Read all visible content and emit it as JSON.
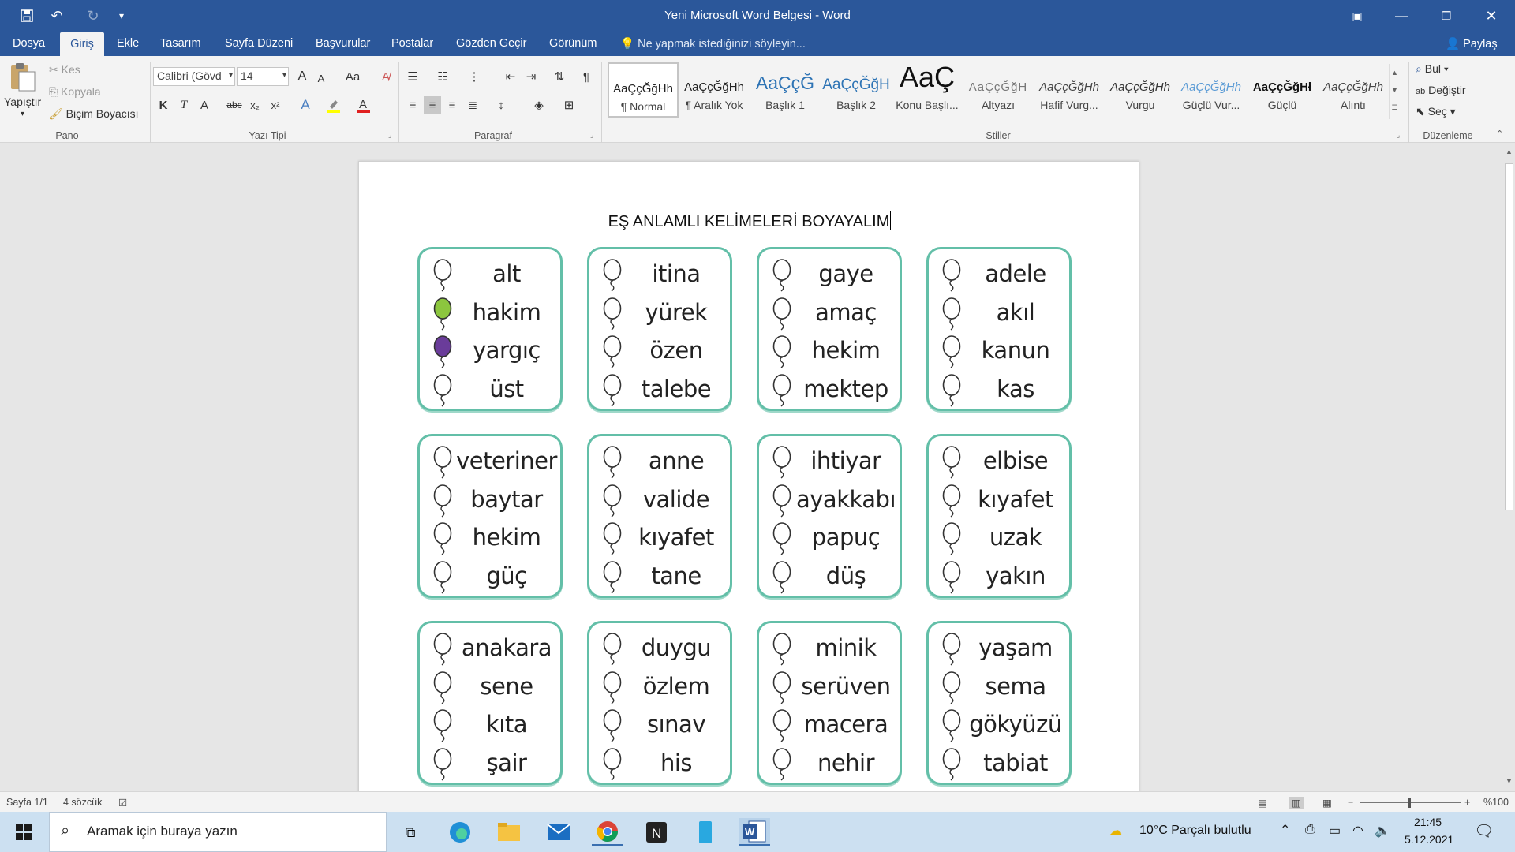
{
  "window": {
    "title": "Yeni Microsoft Word Belgesi - Word",
    "accent": "#2b579a"
  },
  "quick_access": [
    "save-icon",
    "undo-icon",
    "redo-icon",
    "customize-icon"
  ],
  "tabs": [
    "Dosya",
    "Giriş",
    "Ekle",
    "Tasarım",
    "Sayfa Düzeni",
    "Başvurular",
    "Postalar",
    "Gözden Geçir",
    "Görünüm"
  ],
  "tell_me": "Ne yapmak istediğinizi söyleyin...",
  "share": "Paylaş",
  "ribbon": {
    "clipboard": {
      "paste": "Yapıştır",
      "cut": "Kes",
      "copy": "Kopyala",
      "format_painter": "Biçim Boyacısı",
      "label": "Pano"
    },
    "font": {
      "name": "Calibri (Gövd",
      "size": "14",
      "label": "Yazı Tipi",
      "bold": "K",
      "italic": "T",
      "underline": "A",
      "strike": "abc",
      "sub": "x₂",
      "sup": "x²",
      "grow": "A",
      "shrink": "A",
      "case": "Aa"
    },
    "paragraph": {
      "label": "Paragraf"
    },
    "styles": {
      "label": "Stiller",
      "items": [
        {
          "preview": "AaÇçĞğHh",
          "name": "¶ Normal"
        },
        {
          "preview": "AaÇçĞğHh",
          "name": "¶ Aralık Yok"
        },
        {
          "preview": "AaÇçĞ",
          "name": "Başlık 1"
        },
        {
          "preview": "AaÇçĞğH",
          "name": "Başlık 2"
        },
        {
          "preview": "AaÇ",
          "name": "Konu Başlı..."
        },
        {
          "preview": "AaÇçĞğH",
          "name": "Altyazı"
        },
        {
          "preview": "AaÇçĞğHh",
          "name": "Hafif Vurg..."
        },
        {
          "preview": "AaÇçĞğHh",
          "name": "Vurgu"
        },
        {
          "preview": "AaÇçĞğHh",
          "name": "Güçlü Vur..."
        },
        {
          "preview": "AaÇçĞğHł",
          "name": "Güçlü"
        },
        {
          "preview": "AaÇçĞğHh",
          "name": "Alıntı"
        }
      ]
    },
    "editing": {
      "label": "Düzenleme",
      "find": "Bul",
      "replace": "Değiştir",
      "select": "Seç"
    }
  },
  "document": {
    "heading": "EŞ ANLAMLI KELİMELERİ BOYAYALIM",
    "cards": [
      {
        "words": [
          "alt",
          "hakim",
          "yargıç",
          "üst"
        ],
        "colors": [
          "none",
          "#8cc63e",
          "#6a3c9a",
          "none"
        ]
      },
      {
        "words": [
          "itina",
          "yürek",
          "özen",
          "talebe"
        ],
        "colors": [
          "none",
          "none",
          "none",
          "none"
        ]
      },
      {
        "words": [
          "gaye",
          "amaç",
          "hekim",
          "mektep"
        ],
        "colors": [
          "none",
          "none",
          "none",
          "none"
        ]
      },
      {
        "words": [
          "adele",
          "akıl",
          "kanun",
          "kas"
        ],
        "colors": [
          "none",
          "none",
          "none",
          "none"
        ]
      },
      {
        "words": [
          "veteriner",
          "baytar",
          "hekim",
          "güç"
        ],
        "colors": [
          "none",
          "none",
          "none",
          "none"
        ]
      },
      {
        "words": [
          "anne",
          "valide",
          "kıyafet",
          "tane"
        ],
        "colors": [
          "none",
          "none",
          "none",
          "none"
        ]
      },
      {
        "words": [
          "ihtiyar",
          "ayakkabı",
          "papuç",
          "düş"
        ],
        "colors": [
          "none",
          "none",
          "none",
          "none"
        ]
      },
      {
        "words": [
          "elbise",
          "kıyafet",
          "uzak",
          "yakın"
        ],
        "colors": [
          "none",
          "none",
          "none",
          "none"
        ]
      },
      {
        "words": [
          "anakara",
          "sene",
          "kıta",
          "şair"
        ],
        "colors": [
          "none",
          "none",
          "none",
          "none"
        ]
      },
      {
        "words": [
          "duygu",
          "özlem",
          "sınav",
          "his"
        ],
        "colors": [
          "none",
          "none",
          "none",
          "none"
        ]
      },
      {
        "words": [
          "minik",
          "serüven",
          "macera",
          "nehir"
        ],
        "colors": [
          "none",
          "none",
          "none",
          "none"
        ]
      },
      {
        "words": [
          "yaşam",
          "sema",
          "gökyüzü",
          "tabiat"
        ],
        "colors": [
          "none",
          "none",
          "none",
          "none"
        ]
      }
    ]
  },
  "status": {
    "page": "Sayfa 1/1",
    "words": "4 sözcük",
    "zoom": "%100"
  },
  "taskbar": {
    "search_placeholder": "Aramak için buraya yazın",
    "weather": "10°C  Parçalı bulutlu",
    "time": "21:45",
    "date": "5.12.2021",
    "apps": [
      "task-view-icon",
      "edge-icon",
      "file-explorer-icon",
      "mail-icon",
      "chrome-icon",
      "notion-icon",
      "app-icon",
      "word-icon"
    ]
  }
}
